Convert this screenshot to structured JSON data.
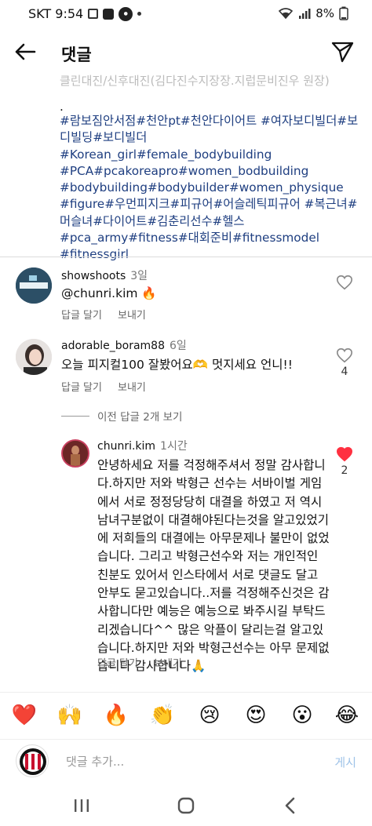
{
  "status_bar": {
    "carrier_time": "SKT 9:54",
    "battery": "8%"
  },
  "header": {
    "title": "댓글"
  },
  "caption": {
    "cut_line": "클린대진/신후대진(김다진수지장장.지럽문비진우 원장)",
    "dot": ".",
    "hashtags": "#람보짐안서점#천안pt#천안다이어트 #여자보디빌더#보디빌딩#보디빌더 #Korean_girl#female_bodybuilding #PCA#pcakoreapro#women_bodbuilding #bodybuilding#bodybuilder#women_physique #figure#우먼피지크#피규어#어슬레틱피규어 #복근녀#머슬녀#다이어트#김춘리선수#헬스 #pca_army#fitness#대회준비#fitnessmodel #fitnessgirl"
  },
  "comments": [
    {
      "username": "showshoots",
      "time": "3일",
      "text": "@chunri.kim 🔥",
      "reply": "답글 달기",
      "send": "보내기",
      "likes": ""
    },
    {
      "username": "adorable_boram88",
      "time": "6일",
      "text": "오늘 피지컬100 잘봤어요🫶 멋지세요 언니!!",
      "reply": "답글 달기",
      "send": "보내기",
      "likes": "4"
    }
  ],
  "view_replies": "이전 답글 2개 보기",
  "reply": {
    "username": "chunri.kim",
    "time": "1시간",
    "text": "안녕하세요 저를 걱정해주셔서 정말 감사합니다.하지만 저와 박형근 선수는 서바이벌 게임에서 서로 정정당당히 대결을 하였고 저 역시 남녀구분없이 대결해야된다는것을 알고있었기에 저희들의 대결에는 아무문제나 불만이 없었습니다. 그리고 박형근선수와 저는 개인적인 친분도 있어서 인스타에서 서로 댓글도 달고 안부도 묻고있습니다..저를 걱정해주신것은 감사합니다만  예능은 예능으로 봐주시길 부탁드리겠습니다^^ 많은 악플이 달리는걸 알고있습니다.하지만 저와 박형근선수는 아무 문제없습니다 감사합니다🙏",
    "reply_label": "답글 달기",
    "send": "보내기",
    "likes": "2"
  },
  "emoji_bar": [
    "❤️",
    "🙌",
    "🔥",
    "👏",
    "😢",
    "😍",
    "😮",
    "😂"
  ],
  "input": {
    "placeholder": "댓글 추가...",
    "post": "게시"
  },
  "colors": {
    "hashtag": "#1e3e80",
    "liked_heart": "#ff3040",
    "post_disabled": "#9fc3e8"
  }
}
